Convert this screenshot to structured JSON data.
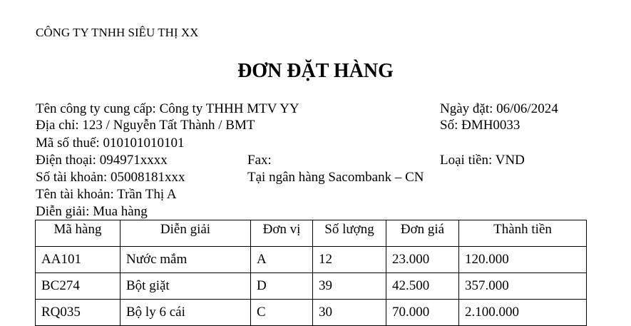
{
  "header": {
    "company": "CÔNG TY TNHH SIÊU THỊ XX",
    "title": "ĐƠN ĐẶT HÀNG"
  },
  "info": {
    "supplier": "Tên công ty cung cấp: Công ty THHH MTV YY",
    "order_date": "Ngày đặt: 06/06/2024",
    "address": "Địa chỉ: 123 / Nguyễn Tất Thành / BMT",
    "order_no": "Số: ĐMH0033",
    "tax_code": "Mã số thuế: 010101010101",
    "phone": "Điện thoại: 094971xxxx",
    "fax": "Fax:",
    "currency": "Loại tiền: VND",
    "account_no": "Số tài khoản: 05008181xxx",
    "bank": "Tại ngân hàng Sacombank – CN",
    "account_name": "Tên tài khoản: Trần Thị A",
    "description": "Diễn giải: Mua hàng"
  },
  "table": {
    "columns": [
      "Mã hàng",
      "Diễn giải",
      "Đơn vị",
      "Số lượng",
      "Đơn giá",
      "Thành tiền"
    ],
    "rows": [
      [
        "AA101",
        "Nước mắm",
        "A",
        "12",
        "23.000",
        "120.000"
      ],
      [
        "BC274",
        "Bột giặt",
        "D",
        "39",
        "42.500",
        "357.000"
      ],
      [
        "RQ035",
        "Bộ ly 6 cái",
        "C",
        "30",
        "70.000",
        "2.100.000"
      ]
    ]
  }
}
